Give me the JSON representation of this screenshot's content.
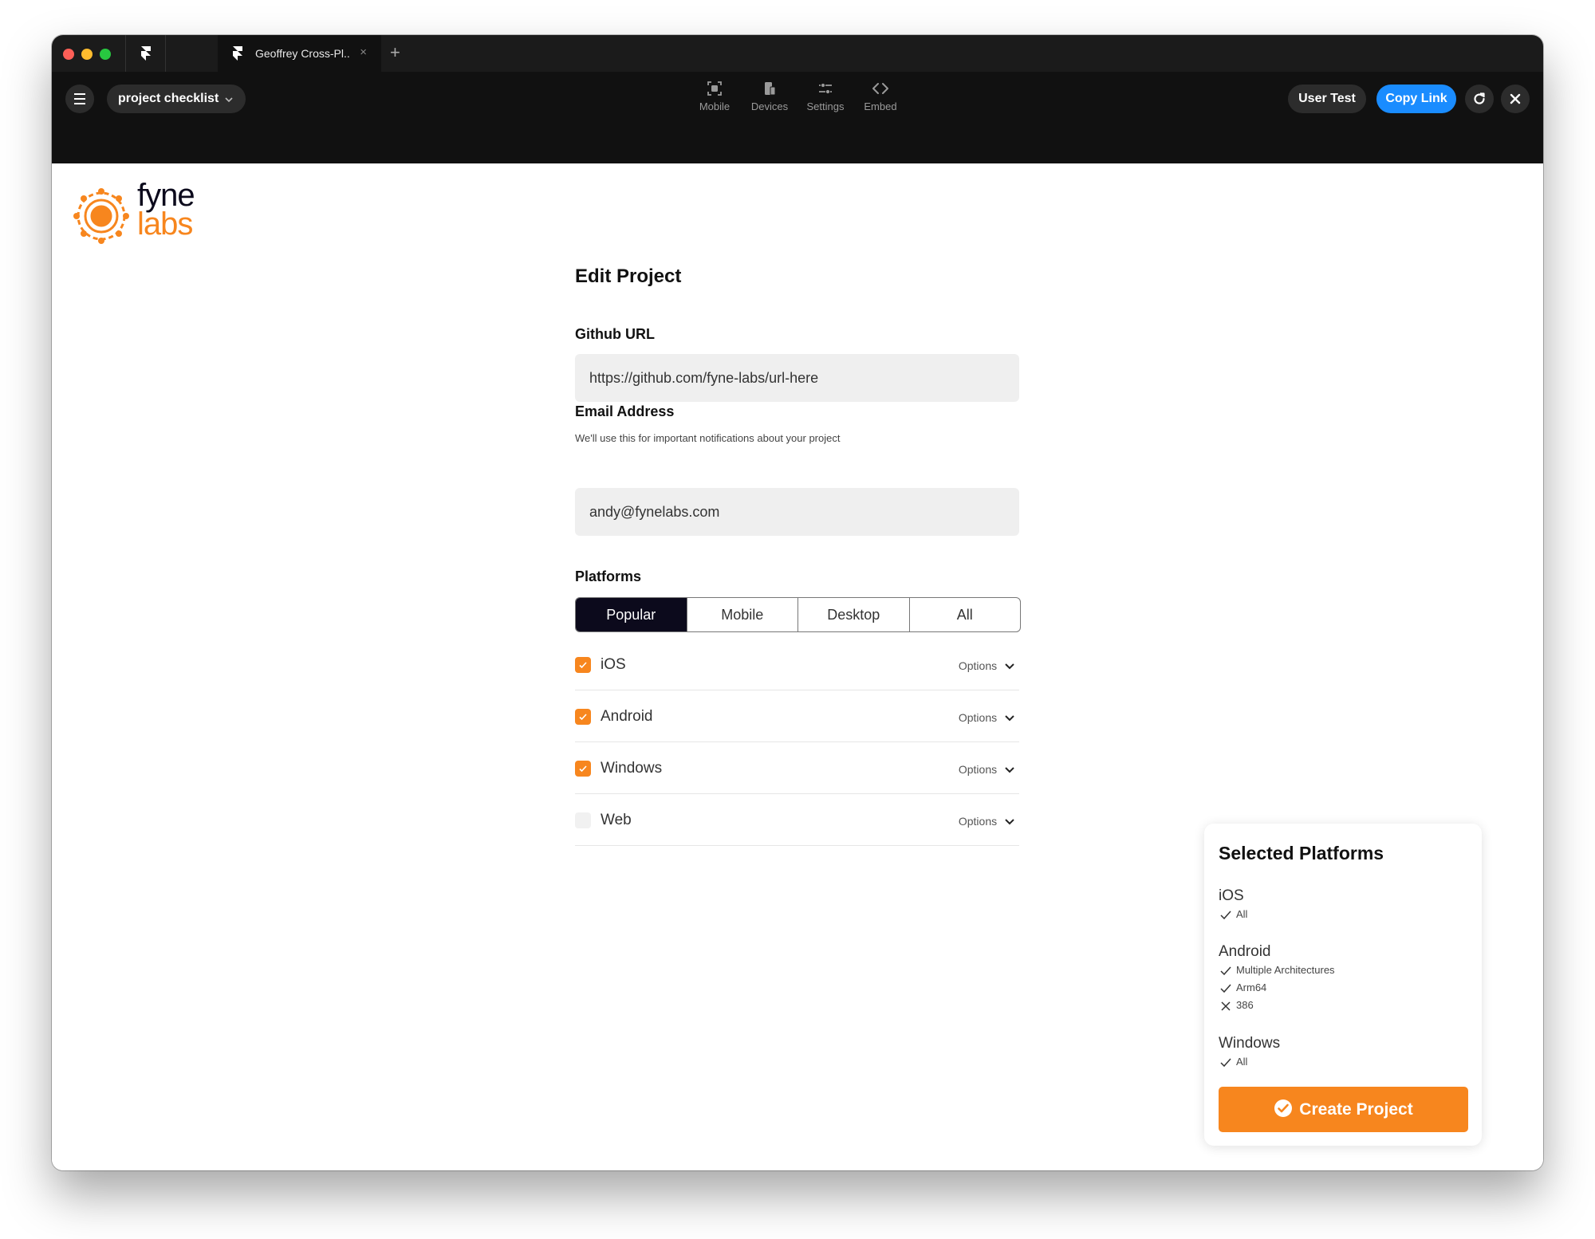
{
  "browser": {
    "tab_title": "Geoffrey Cross-Pl..",
    "new_tab": "+",
    "tab_close": "×"
  },
  "toolbar": {
    "project_name": "project checklist",
    "tools": [
      {
        "label": "Mobile",
        "icon": "mobile-frame-icon"
      },
      {
        "label": "Devices",
        "icon": "devices-icon"
      },
      {
        "label": "Settings",
        "icon": "sliders-icon"
      },
      {
        "label": "Embed",
        "icon": "code-icon"
      }
    ],
    "user_test_label": "User Test",
    "copy_link_label": "Copy Link",
    "accent_color": "#1a8cff"
  },
  "logo": {
    "line1": "fyne",
    "line2": "labs",
    "brand_color": "#f7861e",
    "dark_color": "#0c0a1c"
  },
  "form": {
    "title": "Edit Project",
    "github": {
      "label": "Github URL",
      "value": "https://github.com/fyne-labs/url-here"
    },
    "email": {
      "label": "Email Address",
      "helper": "We'll use this for important notifications about your project",
      "value": "andy@fynelabs.com"
    },
    "platforms": {
      "label": "Platforms",
      "tabs": [
        "Popular",
        "Mobile",
        "Desktop",
        "All"
      ],
      "active_tab": "Popular",
      "items": [
        {
          "name": "iOS",
          "checked": true,
          "options_label": "Options"
        },
        {
          "name": "Android",
          "checked": true,
          "options_label": "Options"
        },
        {
          "name": "Windows",
          "checked": true,
          "options_label": "Options"
        },
        {
          "name": "Web",
          "checked": false,
          "options_label": "Options"
        }
      ]
    }
  },
  "selected": {
    "title": "Selected Platforms",
    "groups": [
      {
        "name": "iOS",
        "features": [
          {
            "text": "All",
            "ok": true
          }
        ]
      },
      {
        "name": "Android",
        "features": [
          {
            "text": "Multiple Architectures",
            "ok": true
          },
          {
            "text": "Arm64",
            "ok": true
          },
          {
            "text": "386",
            "ok": false
          }
        ]
      },
      {
        "name": "Windows",
        "features": [
          {
            "text": "All",
            "ok": true
          }
        ]
      }
    ],
    "create_label": "Create Project"
  }
}
